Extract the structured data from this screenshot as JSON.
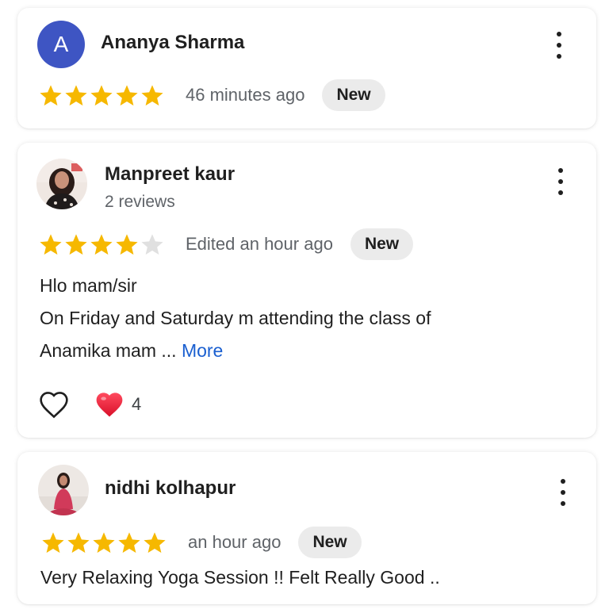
{
  "reviews": [
    {
      "author": "Ananya Sharma",
      "avatar_letter": "A",
      "rating": 5,
      "time": "46 minutes ago",
      "badge": "New"
    },
    {
      "author": "Manpreet kaur",
      "subline": "2 reviews",
      "rating": 4,
      "time": "Edited an hour ago",
      "badge": "New",
      "text_line1": "Hlo mam/sir",
      "text_line2": "On Friday and Saturday m attending the class of",
      "text_line3": "Anamika mam ...",
      "more_label": "More",
      "reaction_count": "4"
    },
    {
      "author": "nidhi kolhapur",
      "rating": 5,
      "time": "an hour ago",
      "badge": "New",
      "text_line1": "Very Relaxing Yoga Session !! Felt Really Good .."
    }
  ],
  "colors": {
    "star_filled": "#f6b800",
    "star_empty": "#e0e0e0",
    "link": "#1a5fd0",
    "avatar_bg": "#3e55c3",
    "heart": "#e8213a"
  }
}
